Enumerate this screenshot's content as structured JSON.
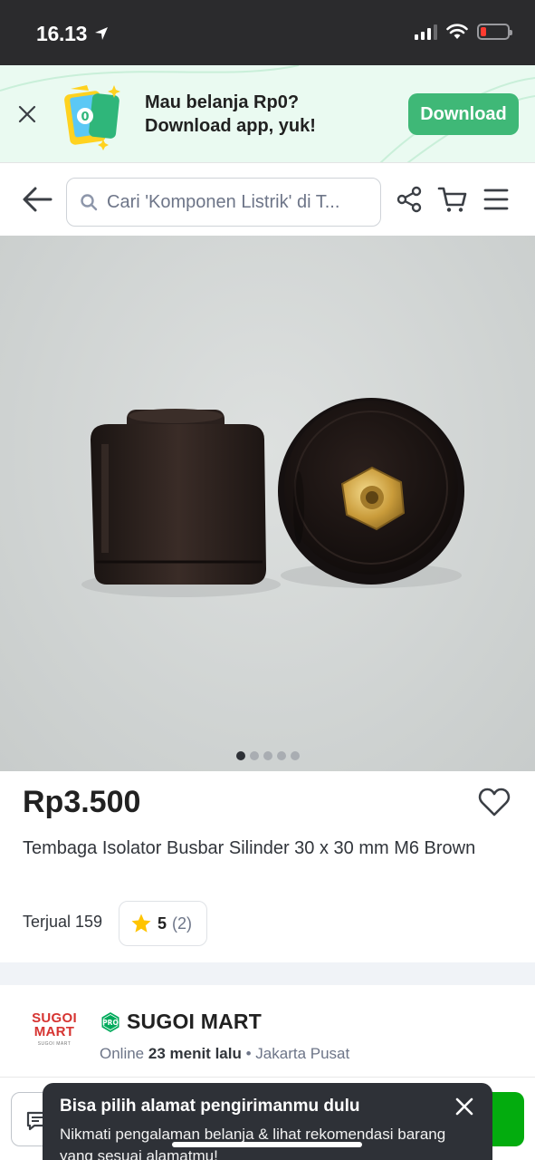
{
  "status_bar": {
    "time": "16.13",
    "location_arrow": "location-arrow-icon",
    "signal": "signal-icon",
    "wifi": "wifi-icon",
    "battery": "battery-low-icon",
    "battery_color": "#ff3b30"
  },
  "app_banner": {
    "line1": "Mau belanja Rp0?",
    "line2": "Download app, yuk!",
    "download_label": "Download",
    "accent": "#3fb877",
    "close_icon": "close-icon"
  },
  "header": {
    "search_placeholder": "Cari 'Komponen Listrik' di T...",
    "icons": [
      "back-arrow-icon",
      "search-icon",
      "share-icon",
      "cart-icon",
      "menu-icon"
    ]
  },
  "gallery": {
    "image_count": 5,
    "active_index": 0
  },
  "product": {
    "price": "Rp3.500",
    "title": "Tembaga Isolator Busbar Silinder 30 x 30 mm M6 Brown",
    "sold": "Terjual 159",
    "rating": "5",
    "rating_count": "(2)"
  },
  "shop": {
    "logo_line1": "SUGOI",
    "logo_line2": "MART",
    "badge": "PRO",
    "name": "SUGOI MART",
    "status_prefix": "Online",
    "last_online": "23 menit lalu",
    "separator": "•",
    "location": "Jakarta Pusat"
  },
  "toast": {
    "title": "Bisa pilih alamat pengirimanmu dulu",
    "body": "Nikmati pengalaman belanja & lihat rekomendasi barang yang sesuai alamatmu!"
  },
  "colors": {
    "primary_green": "#03ac0e",
    "toast_bg": "#2e3137",
    "star": "#ffc400"
  }
}
